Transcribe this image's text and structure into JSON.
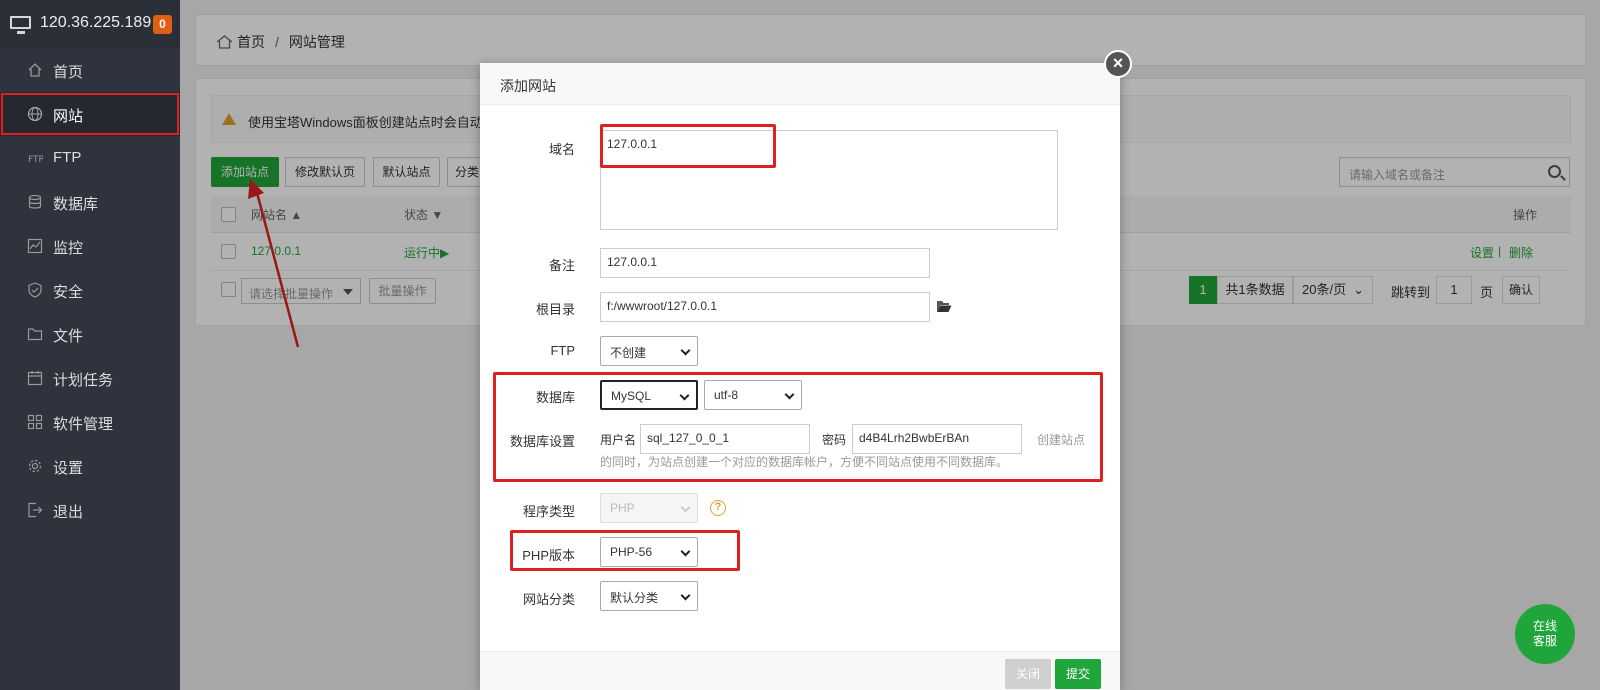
{
  "server": {
    "ip": "120.36.225.189",
    "badge": "0"
  },
  "sidebar": {
    "items": [
      {
        "label": "首页",
        "icon": "home-icon"
      },
      {
        "label": "网站",
        "icon": "globe-icon"
      },
      {
        "label": "FTP",
        "icon": "ftp-icon"
      },
      {
        "label": "数据库",
        "icon": "database-icon"
      },
      {
        "label": "监控",
        "icon": "monitor-icon"
      },
      {
        "label": "安全",
        "icon": "shield-icon"
      },
      {
        "label": "文件",
        "icon": "folder-icon"
      },
      {
        "label": "计划任务",
        "icon": "calendar-icon"
      },
      {
        "label": "软件管理",
        "icon": "apps-icon"
      },
      {
        "label": "设置",
        "icon": "gear-icon"
      },
      {
        "label": "退出",
        "icon": "logout-icon"
      }
    ]
  },
  "breadcrumb": {
    "home": "首页",
    "current": "网站管理"
  },
  "alert": {
    "text": "使用宝塔Windows面板创建站点时会自动创"
  },
  "toolbar": {
    "add_site": "添加站点",
    "edit_default": "修改默认页",
    "default_site": "默认站点",
    "category": "分类"
  },
  "search": {
    "placeholder": "请输入域名或备注"
  },
  "table": {
    "headers": {
      "name": "网站名",
      "status": "状态",
      "ops": "操作"
    },
    "row": {
      "name": "127.0.0.1",
      "status": "运行中▶",
      "extra": ".1",
      "set": "设置",
      "sep": "|",
      "delete": "删除"
    }
  },
  "batch": {
    "select": "请选择批量操作",
    "button": "批量操作"
  },
  "pagination": {
    "page": "1",
    "total": "共1条数据",
    "per_page": "20条/页",
    "jump_label": "跳转到",
    "jump_value": "1",
    "page_unit": "页",
    "confirm": "确认"
  },
  "modal": {
    "title": "添加网站",
    "domain_label": "域名",
    "domain_value": "127.0.0.1",
    "remark_label": "备注",
    "remark_value": "127.0.0.1",
    "root_label": "根目录",
    "root_value": "f:/wwwroot/127.0.0.1",
    "ftp_label": "FTP",
    "ftp_value": "不创建",
    "db_label": "数据库",
    "db_value": "MySQL",
    "charset_value": "utf-8",
    "dbset_label": "数据库设置",
    "user_label": "用户名",
    "user_value": "sql_127_0_0_1",
    "pass_label": "密码",
    "pass_value": "d4B4Lrh2BwbErBAn",
    "note_line1": "创建站点",
    "note_line2": "的同时，为站点创建一个对应的数据库帐户，方便不同站点使用不同数据库。",
    "type_label": "程序类型",
    "type_value": "PHP",
    "php_label": "PHP版本",
    "php_value": "PHP-56",
    "cat_label": "网站分类",
    "cat_value": "默认分类",
    "close": "关闭",
    "submit": "提交"
  },
  "chat": {
    "line1": "在线",
    "line2": "客服"
  },
  "colors": {
    "accent": "#20a53a",
    "highlight": "#e02020",
    "sidebar": "#2f333d",
    "badge": "#e05f15"
  }
}
